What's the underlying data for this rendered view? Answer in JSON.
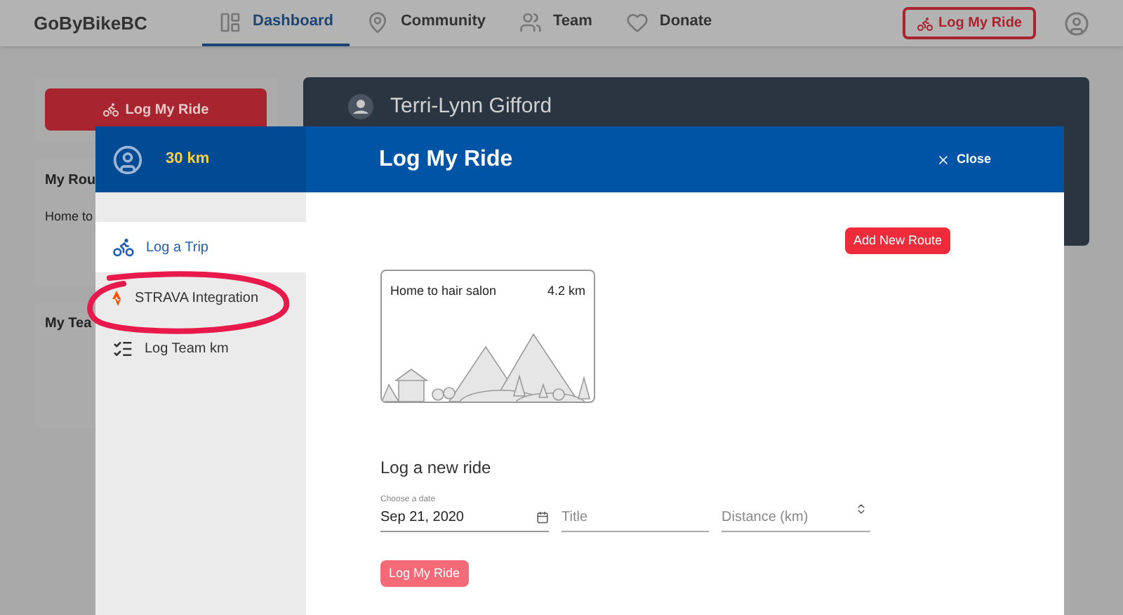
{
  "nav": {
    "logo": "GoByBikeBC",
    "items": [
      {
        "label": "Dashboard",
        "kind": "dashboard",
        "selected": true
      },
      {
        "label": "Community",
        "kind": "pin",
        "selected": false
      },
      {
        "label": "Team",
        "kind": "team",
        "selected": false
      },
      {
        "label": "Donate",
        "kind": "heart",
        "selected": false
      }
    ],
    "log_button": "Log My Ride"
  },
  "background": {
    "log_button": "Log My Ride",
    "cards": [
      {
        "title": "My Rou",
        "text": "Home to"
      },
      {
        "title": "My Tea"
      }
    ],
    "profile_name": "Terri-Lynn Gifford"
  },
  "modal": {
    "distance": "30 km",
    "title": "Log My Ride",
    "close": "Close",
    "menu": [
      {
        "label": "Log a Trip",
        "kind": "bike",
        "selected": true
      },
      {
        "label": "STRAVA Integration",
        "kind": "strava",
        "selected": false
      },
      {
        "label": "Log Team km",
        "kind": "list",
        "selected": false
      }
    ],
    "add_route": "Add New Route",
    "routes": [
      {
        "name": "Home to hair salon",
        "distance": "4.2 km"
      }
    ],
    "new_ride": {
      "heading": "Log a new ride",
      "date": {
        "label": "Choose a date",
        "value": "Sep 21, 2020"
      },
      "title": {
        "placeholder": "Title"
      },
      "distance": {
        "placeholder": "Distance (km)"
      },
      "submit": {
        "label": "Log My Ride",
        "disabled": true
      }
    }
  }
}
